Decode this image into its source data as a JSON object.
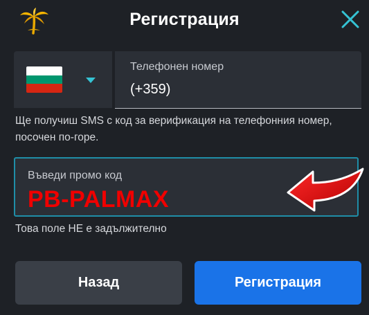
{
  "header": {
    "logo_icon": "palm-tree-logo-icon",
    "title": "Регистрация",
    "close_icon": "close-icon",
    "accent_color": "#35c3d4"
  },
  "phone": {
    "country_flag": "bulgaria-flag-icon",
    "dropdown_icon": "chevron-down-icon",
    "label": "Телефонен номер",
    "value": "(+359)"
  },
  "sms_hint": "Ще получиш SMS с код за верификация на телефонния номер, посочен по-горе.",
  "promo": {
    "label": "Въведи промо код",
    "value": "PB-PALMAX",
    "value_color": "#f00000",
    "annotation_icon": "red-arrow-icon"
  },
  "promo_optional_note": "Това поле НЕ е задължително",
  "buttons": {
    "back_label": "Назад",
    "register_label": "Регистрация",
    "register_color": "#1a73e8"
  }
}
